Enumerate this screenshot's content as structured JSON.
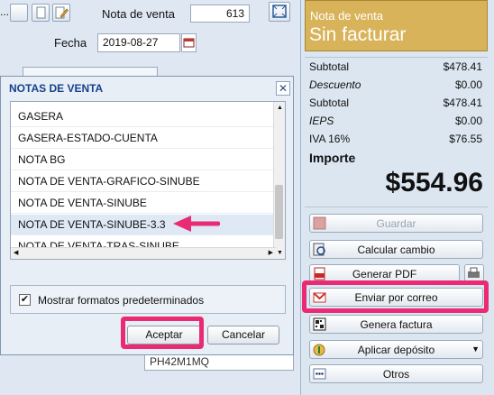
{
  "header": {
    "toolbar_more": "...",
    "sale_note_label": "Nota de venta",
    "sale_note_value": "613",
    "date_label": "Fecha",
    "date_value": "2019-08-27",
    "bottom_field_value": "PH42M1MQ"
  },
  "status": {
    "title": "Nota de venta",
    "state": "Sin facturar",
    "color": "#d9b35a"
  },
  "summary": {
    "rows": [
      {
        "label": "Subtotal",
        "value": "$478.41",
        "italic": false
      },
      {
        "label": "Descuento",
        "value": "$0.00",
        "italic": true
      },
      {
        "label": "Subtotal",
        "value": "$478.41",
        "italic": false
      },
      {
        "label": "IEPS",
        "value": "$0.00",
        "italic": true
      },
      {
        "label": "IVA 16%",
        "value": "$76.55",
        "italic": false
      }
    ],
    "total_label": "Importe",
    "total_value": "$554.96"
  },
  "actions": {
    "save": "Guardar",
    "calc_change": "Calcular cambio",
    "pdf": "Generar PDF",
    "email": "Enviar por correo",
    "invoice": "Genera factura",
    "deposit": "Aplicar depósito",
    "others": "Otros"
  },
  "dialog": {
    "title": "NOTAS DE VENTA",
    "close": "✕",
    "items": [
      "GASERA",
      "GASERA-ESTADO-CUENTA",
      "NOTA BG",
      "NOTA DE VENTA-GRAFICO-SINUBE",
      "NOTA DE VENTA-SINUBE",
      "NOTA DE VENTA-SINUBE-3.3",
      "NOTA DE VENTA-TRAS-SINUBE"
    ],
    "selected_index": 5,
    "checkbox_label": "Mostrar formatos predeterminados",
    "checkbox_checked": true,
    "accept": "Aceptar",
    "cancel": "Cancelar"
  },
  "colors": {
    "highlight": "#ea2b74",
    "accent": "#15428b"
  }
}
